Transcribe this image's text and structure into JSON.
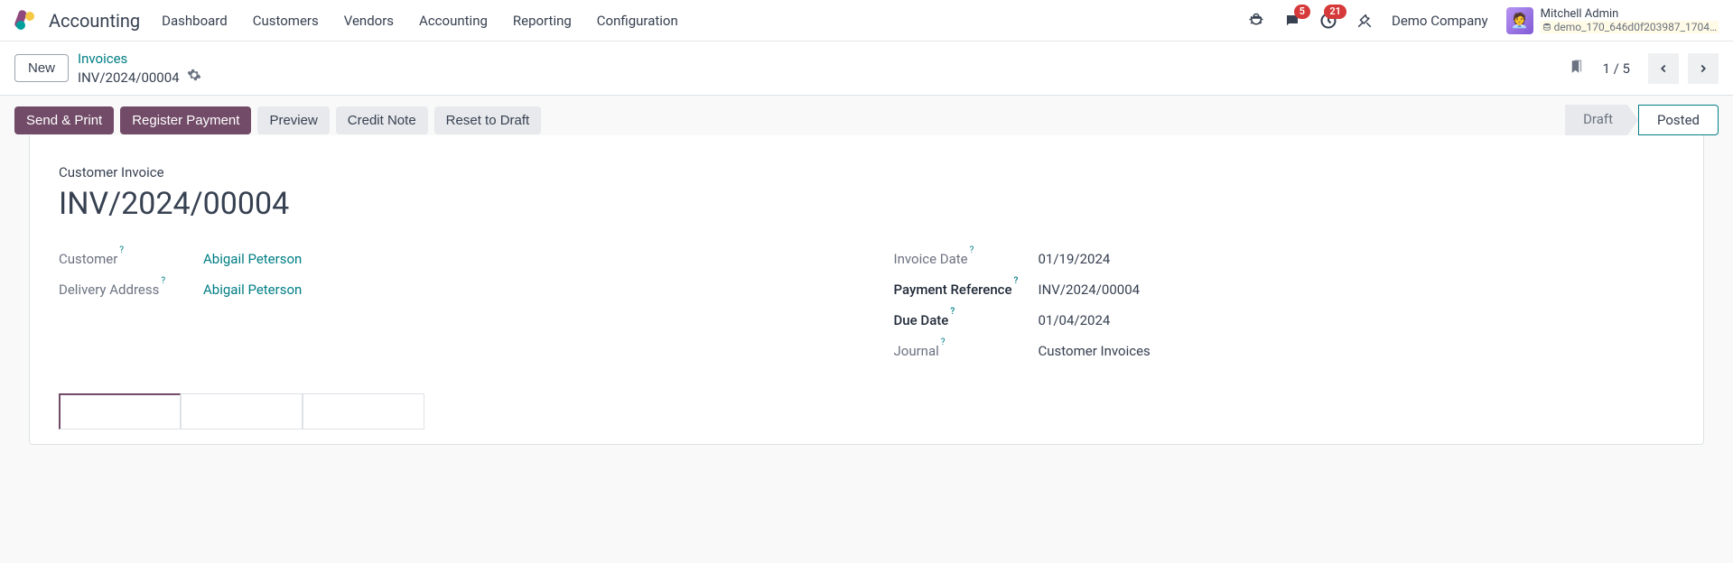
{
  "navbar": {
    "app_name": "Accounting",
    "menu": [
      "Dashboard",
      "Customers",
      "Vendors",
      "Accounting",
      "Reporting",
      "Configuration"
    ],
    "messages_badge": "5",
    "activities_badge": "21",
    "company": "Demo Company",
    "user_name": "Mitchell Admin",
    "database": "demo_170_646d0f203987_1704…"
  },
  "breadcrumb": {
    "new_btn": "New",
    "parent": "Invoices",
    "current": "INV/2024/00004",
    "pager": "1 / 5"
  },
  "actions": {
    "send_print": "Send & Print",
    "register_payment": "Register Payment",
    "preview": "Preview",
    "credit_note": "Credit Note",
    "reset_draft": "Reset to Draft"
  },
  "status": {
    "draft": "Draft",
    "posted": "Posted"
  },
  "form": {
    "type_label": "Customer Invoice",
    "name": "INV/2024/00004",
    "left": {
      "customer_label": "Customer",
      "customer_value": "Abigail Peterson",
      "delivery_label": "Delivery Address",
      "delivery_value": "Abigail Peterson"
    },
    "right": {
      "invoice_date_label": "Invoice Date",
      "invoice_date_value": "01/19/2024",
      "payment_ref_label": "Payment Reference",
      "payment_ref_value": "INV/2024/00004",
      "due_date_label": "Due Date",
      "due_date_value": "01/04/2024",
      "journal_label": "Journal",
      "journal_value": "Customer Invoices"
    }
  }
}
